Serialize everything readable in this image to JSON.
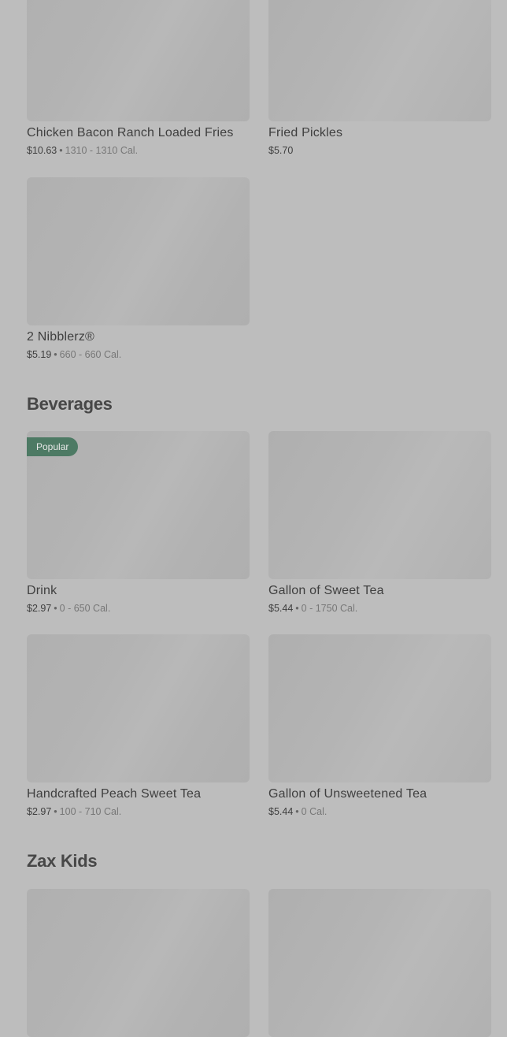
{
  "sides": {
    "items": [
      {
        "name": "Chicken Bacon Ranch Loaded Fries",
        "price": "$10.63",
        "calories": "1310 - 1310 Cal."
      },
      {
        "name": "Fried Pickles",
        "price": "$5.70",
        "calories": ""
      },
      {
        "name": "2 Nibblerz®",
        "price": "$5.19",
        "calories": "660 - 660 Cal."
      }
    ]
  },
  "beverages": {
    "title": "Beverages",
    "items": [
      {
        "name": "Drink",
        "price": "$2.97",
        "calories": "0 - 650 Cal.",
        "badge": "Popular"
      },
      {
        "name": "Gallon of Sweet Tea",
        "price": "$5.44",
        "calories": "0 - 1750 Cal."
      },
      {
        "name": "Handcrafted Peach Sweet Tea",
        "price": "$2.97",
        "calories": "100 - 710 Cal."
      },
      {
        "name": "Gallon of Unsweetened Tea",
        "price": "$5.44",
        "calories": "0 Cal."
      }
    ]
  },
  "zax_kids": {
    "title": "Zax Kids"
  },
  "colors": {
    "overlay_bg": "#bdbdbd",
    "badge_bg": "#4d7a64",
    "text": "#3f3f3f"
  }
}
